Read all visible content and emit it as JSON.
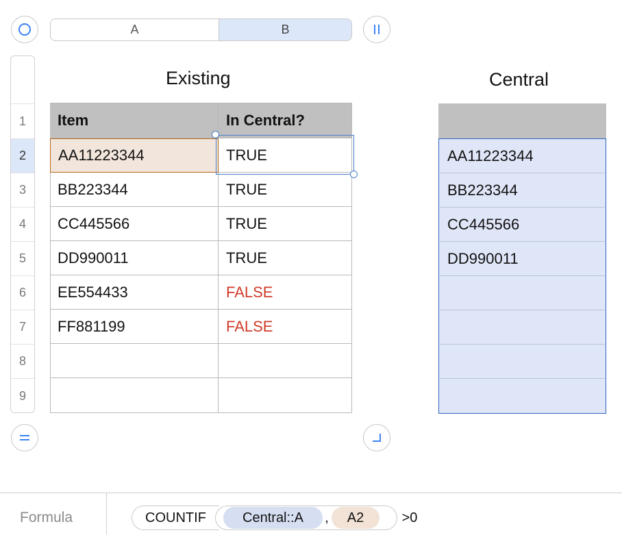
{
  "columns": {
    "a": "A",
    "b": "B"
  },
  "rows": [
    "1",
    "2",
    "3",
    "4",
    "5",
    "6",
    "7",
    "8",
    "9"
  ],
  "existing": {
    "title": "Existing",
    "headers": [
      "Item",
      "In Central?"
    ],
    "data": [
      [
        "AA11223344",
        "TRUE"
      ],
      [
        "BB223344",
        "TRUE"
      ],
      [
        "CC445566",
        "TRUE"
      ],
      [
        "DD990011",
        "TRUE"
      ],
      [
        "EE554433",
        "FALSE"
      ],
      [
        "FF881199",
        "FALSE"
      ],
      [
        "",
        ""
      ],
      [
        "",
        ""
      ]
    ]
  },
  "central": {
    "title": "Central",
    "header": "",
    "items": [
      "AA11223344",
      "BB223344",
      "CC445566",
      "DD990011",
      "",
      "",
      "",
      ""
    ]
  },
  "formula": {
    "label": "Formula",
    "function": "COUNTIF",
    "arg1": "Central::A",
    "comma": ",",
    "arg2": "A2",
    "suffix": ">0"
  },
  "colors": {
    "selected_cell_fill": "#f2e6dc",
    "selected_cell_border": "#b5651d",
    "active_border": "#4a7fc9",
    "false_text": "#d13b2a",
    "central_fill": "#dfe6f8"
  }
}
